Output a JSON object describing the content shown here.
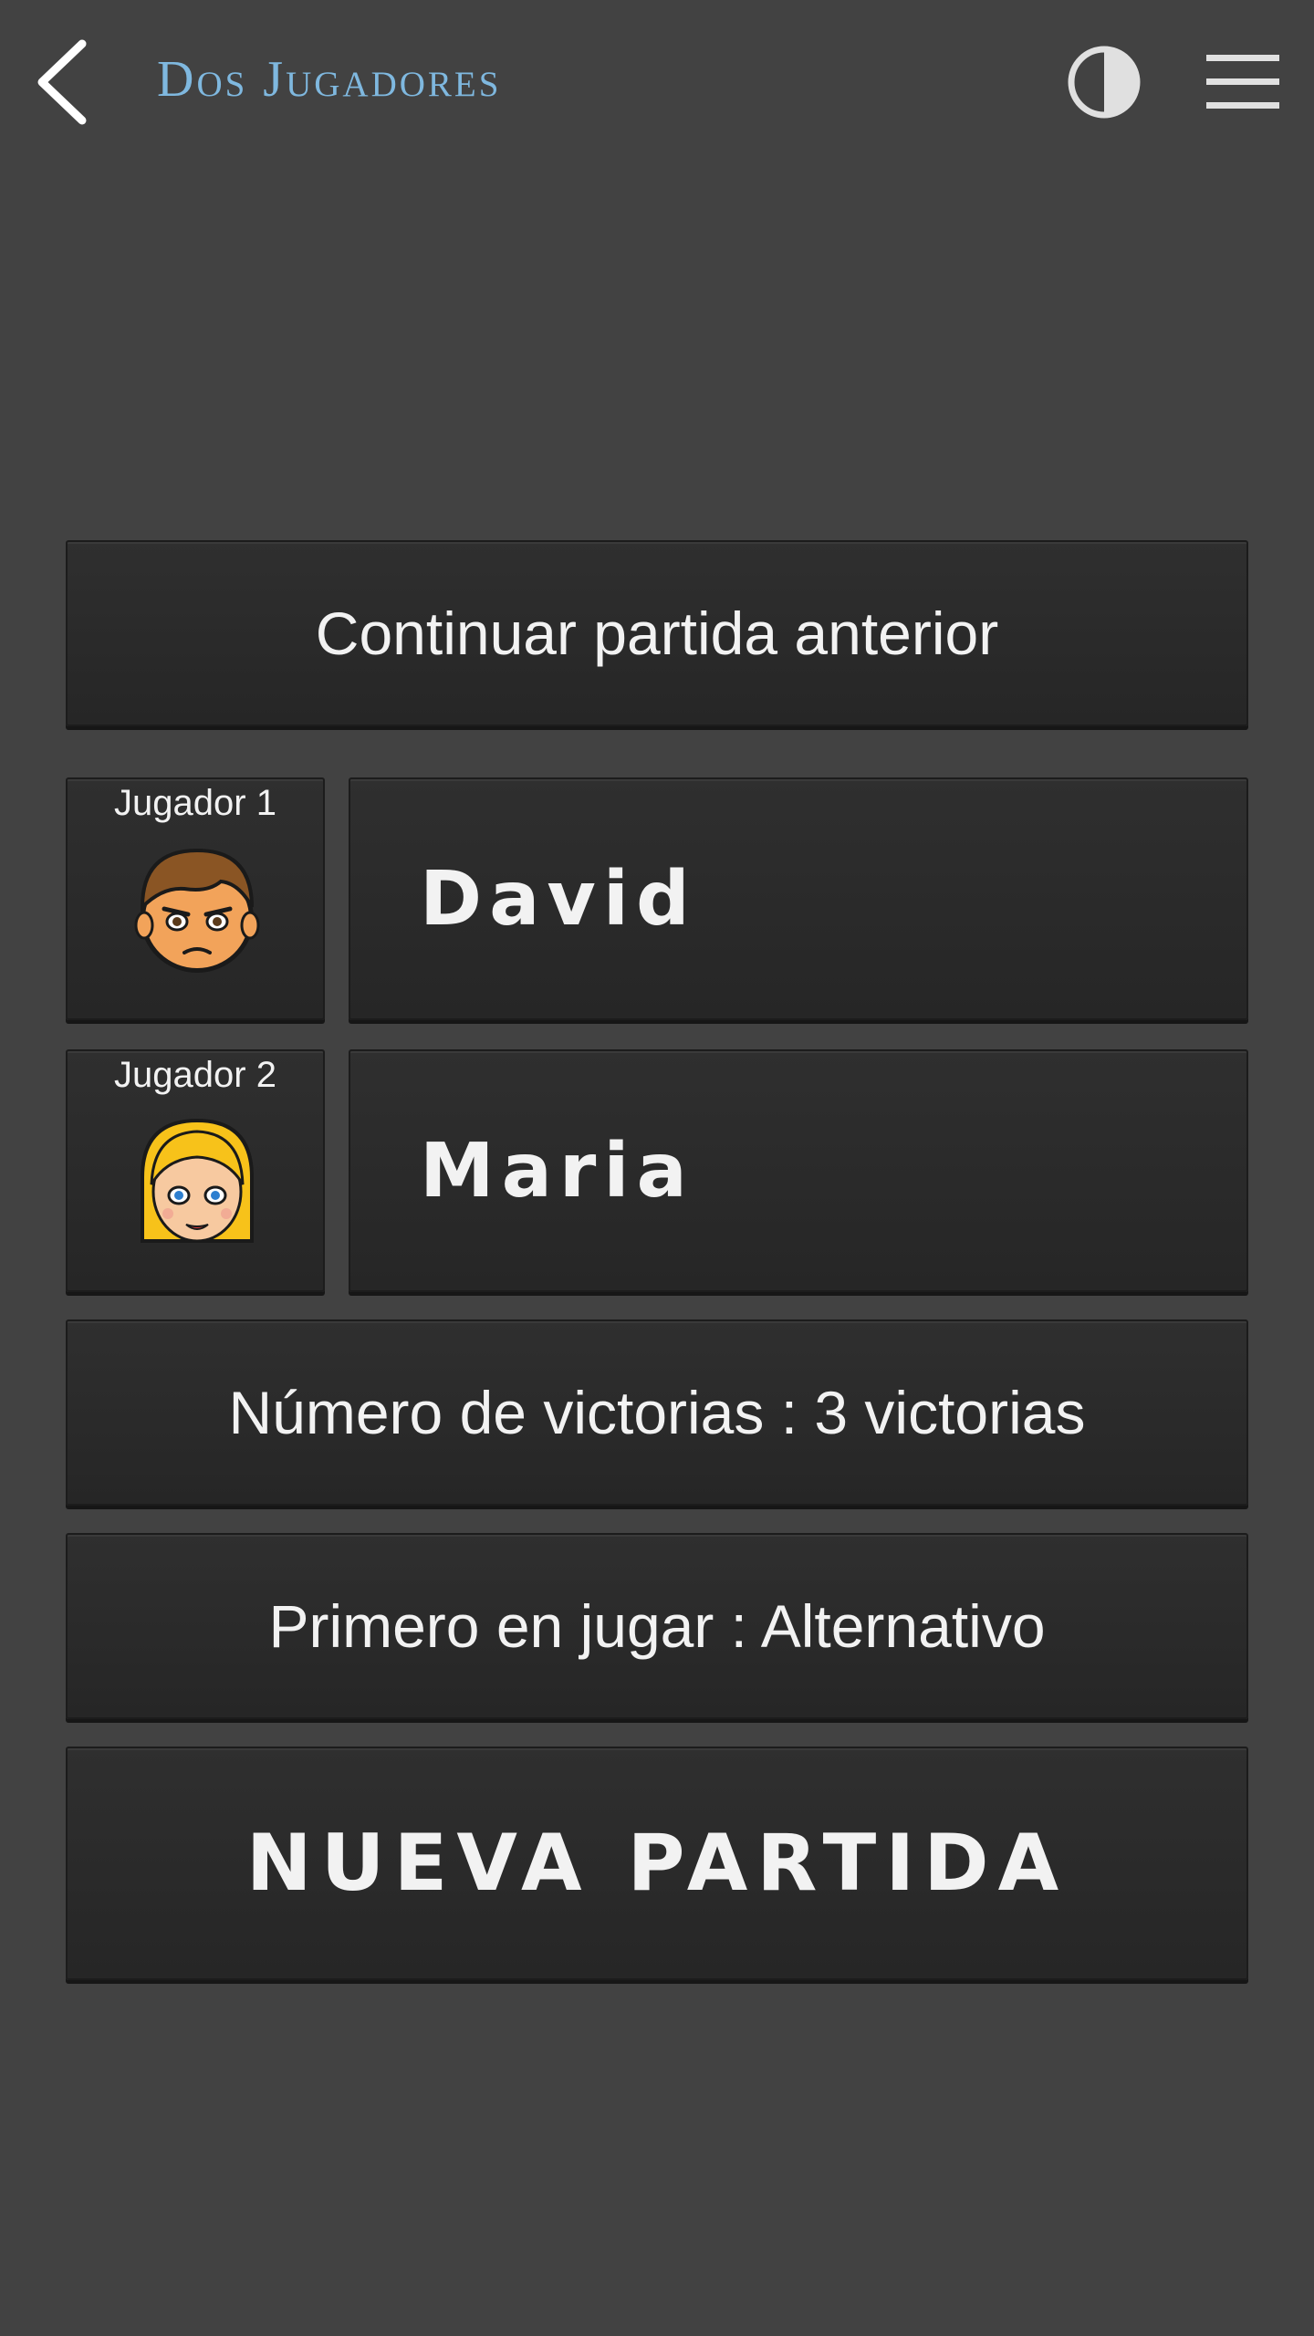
{
  "header": {
    "title": "Dos Jugadores",
    "icons": {
      "back": "back-arrow-icon",
      "contrast": "contrast-icon",
      "menu": "hamburger-menu-icon"
    },
    "title_color": "#7fb8df"
  },
  "continue_label": "Continuar partida anterior",
  "players": [
    {
      "label": "Jugador 1",
      "name": "David",
      "avatar": "boy-avatar-icon"
    },
    {
      "label": "Jugador 2",
      "name": "Maria",
      "avatar": "girl-avatar-icon"
    }
  ],
  "victories_label": "Número de victorias : 3 victorias",
  "first_player_label": "Primero en jugar : Alternativo",
  "new_game_label": "NUEVA PARTIDA",
  "colors": {
    "background": "#424242",
    "panel": "#2a2a2a"
  }
}
